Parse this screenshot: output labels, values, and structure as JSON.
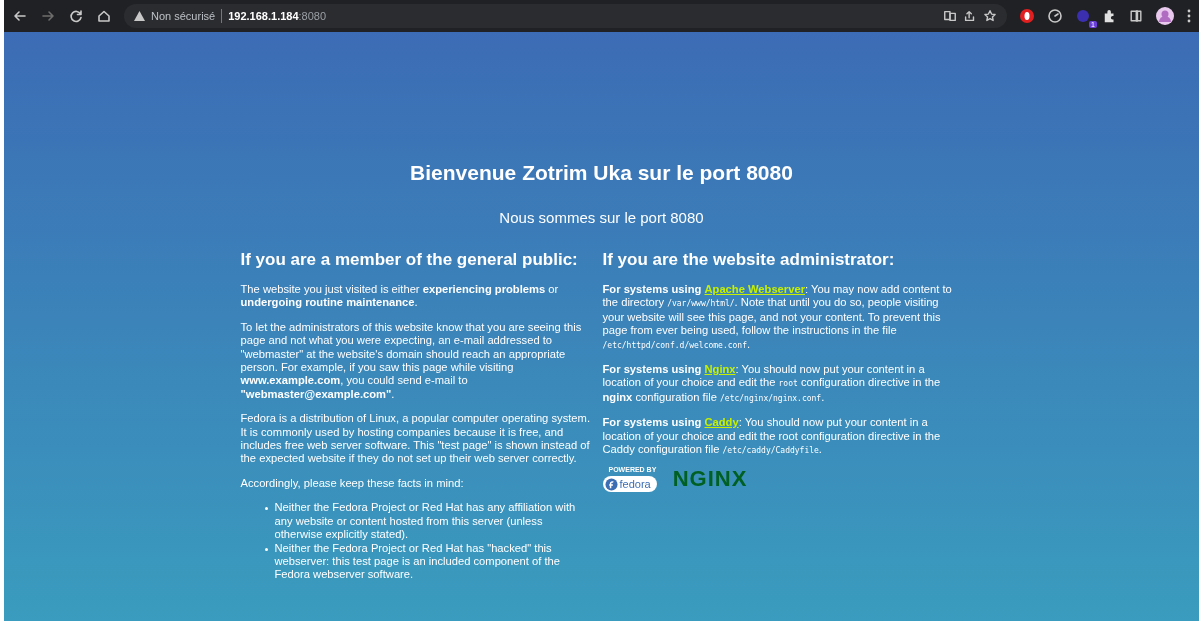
{
  "browser": {
    "security_label": "Non sécurisé",
    "url_host": "192.168.1.184",
    "url_port": ":8080",
    "extension_badge": "1"
  },
  "page": {
    "title": "Bienvenue Zotrim Uka sur le port 8080",
    "subtitle": "Nous sommes sur le port 8080",
    "columns": [
      {
        "heading": "If you are a member of the general public:",
        "blocks": [
          {
            "kind": "paragraph",
            "segments": [
              {
                "kind": "text",
                "text": "The website you just visited is either **experiencing problems** or **undergoing routine maintenance**."
              }
            ]
          },
          {
            "kind": "paragraph",
            "segments": [
              {
                "kind": "text",
                "text": "To let the administrators of this website know that you are seeing this page and not what you were expecting, an e-mail addressed to \"webmaster\" at the website's domain should reach an appropriate person. For example, if you saw this page while visiting **www.example.com**, you could send e-mail to **\"webmaster@example.com\"**."
              }
            ]
          },
          {
            "kind": "paragraph",
            "segments": [
              {
                "kind": "text",
                "text": "Fedora is a distribution of Linux, a popular computer operating system. It is commonly used by hosting companies because it is free, and includes free web server software. This \"test page\" is shown instead of the expected website if they do not set up their web server correctly."
              }
            ]
          },
          {
            "kind": "paragraph",
            "segments": [
              {
                "kind": "text",
                "text": "Accordingly, please keep these facts in mind:"
              }
            ]
          },
          {
            "kind": "list",
            "items": [
              "Neither the Fedora Project or Red Hat has any affiliation with any website or content hosted from this server (unless otherwise explicitly stated).",
              "Neither the Fedora Project or Red Hat has \"hacked\" this webserver: this test page is an included component of the Fedora webserver software."
            ]
          }
        ]
      },
      {
        "heading": "If you are the website administrator:",
        "blocks": [
          {
            "kind": "paragraph",
            "segments": [
              {
                "kind": "text",
                "text": "**For systems using** "
              },
              {
                "kind": "link",
                "text": "Apache Webserver"
              },
              {
                "kind": "text",
                "text": ": You may now add content to the directory "
              },
              {
                "kind": "code",
                "text": "/var/www/html/"
              },
              {
                "kind": "text",
                "text": ". Note that until you do so, people visiting your website will see this page, and not your content. To prevent this page from ever being used, follow the instructions in the file "
              },
              {
                "kind": "code",
                "text": "/etc/httpd/conf.d/welcome.conf"
              },
              {
                "kind": "text",
                "text": "."
              }
            ]
          },
          {
            "kind": "paragraph",
            "segments": [
              {
                "kind": "text",
                "text": "**For systems using** "
              },
              {
                "kind": "link",
                "text": "Nginx"
              },
              {
                "kind": "text",
                "text": ": You should now put your content in a location of your choice and edit the "
              },
              {
                "kind": "code",
                "text": "root"
              },
              {
                "kind": "text",
                "text": " configuration directive in the **nginx** configuration file "
              },
              {
                "kind": "code",
                "text": "/etc/nginx/nginx.conf"
              },
              {
                "kind": "text",
                "text": "."
              }
            ]
          },
          {
            "kind": "paragraph",
            "segments": [
              {
                "kind": "text",
                "text": "**For systems using** "
              },
              {
                "kind": "link",
                "text": "Caddy"
              },
              {
                "kind": "text",
                "text": ": You should now put your content in a location of your choice and edit the root configuration directive in the Caddy configuration file "
              },
              {
                "kind": "code",
                "text": "/etc/caddy/Caddyfile"
              },
              {
                "kind": "text",
                "text": "."
              }
            ]
          },
          {
            "kind": "logos",
            "fedora_caption": "POWERED BY",
            "fedora_name": "fedora",
            "nginx_name": "NGINX"
          }
        ]
      }
    ]
  }
}
